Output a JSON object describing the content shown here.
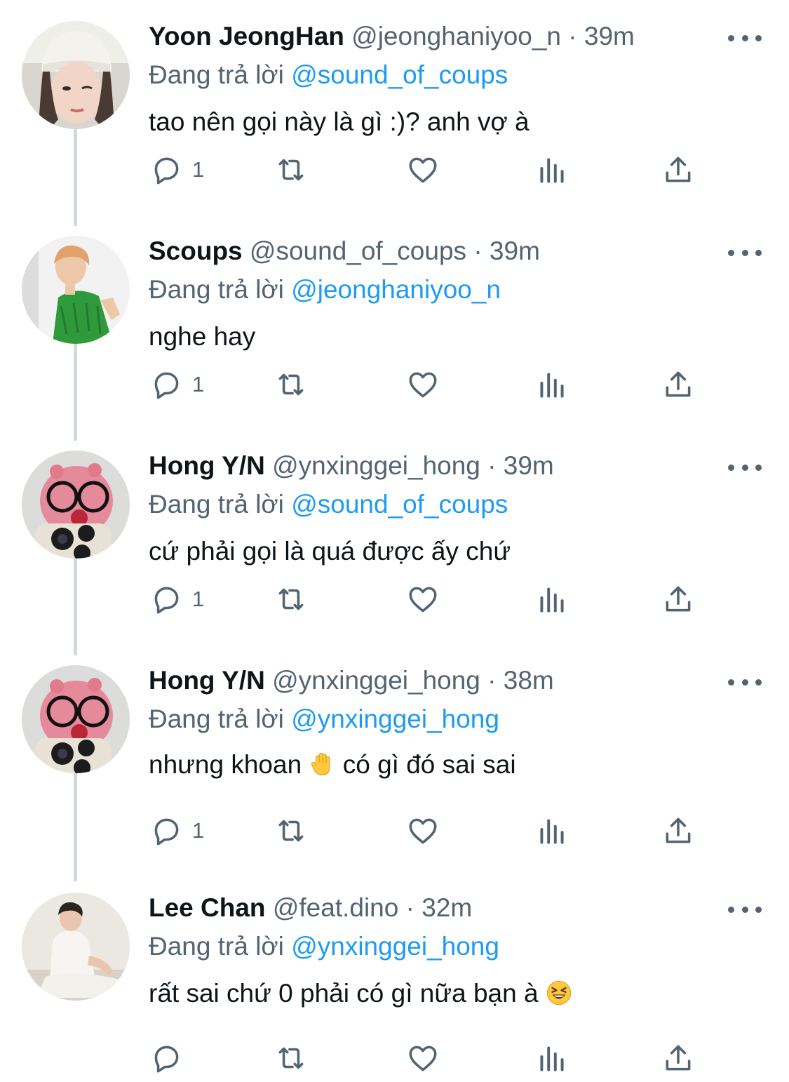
{
  "tweets": [
    {
      "name": "Yoon JeongHan",
      "handle": "@jeonghaniyoo_n",
      "time": "· 39m",
      "reply_label": "Đang trả lời",
      "reply_to": "@sound_of_coups",
      "text": "tao nên gọi này là gì :)? anh vợ à",
      "reply_count": "1",
      "avatar": "avatar-white-beanie"
    },
    {
      "name": "Scoups",
      "handle": "@sound_of_coups",
      "time": "· 39m",
      "reply_label": "Đang trả lời",
      "reply_to": "@jeonghaniyoo_n",
      "text": "nghe hay",
      "reply_count": "1",
      "avatar": "avatar-green-shirt"
    },
    {
      "name": "Hong Y/N",
      "handle": "@ynxinggei_hong",
      "time": "· 39m",
      "reply_label": "Đang trả lời",
      "reply_to": "@sound_of_coups",
      "text": "cứ phải gọi là quá được ấy chứ",
      "reply_count": "1",
      "avatar": "avatar-pink-plush"
    },
    {
      "name": "Hong Y/N",
      "handle": "@ynxinggei_hong",
      "time": "· 38m",
      "reply_label": "Đang trả lời",
      "reply_to": "@ynxinggei_hong",
      "text_before": "nhưng khoan",
      "text_emoji": "raised-hand-emoji",
      "text_after": "có gì đó sai sai",
      "reply_count": "1",
      "avatar": "avatar-pink-plush"
    },
    {
      "name": "Lee Chan",
      "handle": "@feat.dino",
      "time": "· 32m",
      "reply_label": "Đang trả lời",
      "reply_to": "@ynxinggei_hong",
      "text_before": "rất sai chứ 0 phải có gì nữa bạn à",
      "text_emoji": "laughing-squint-emoji",
      "reply_count": "",
      "avatar": "avatar-white-tee"
    }
  ],
  "icons": {
    "reply": "reply-icon",
    "retweet": "retweet-icon",
    "like": "heart-icon",
    "views": "views-icon",
    "share": "share-icon",
    "more": "more-icon"
  },
  "colors": {
    "mention": "#1d9bf0",
    "secondary_text": "#536471",
    "primary_text": "#0f1419",
    "thread_line": "#cfd9de"
  }
}
